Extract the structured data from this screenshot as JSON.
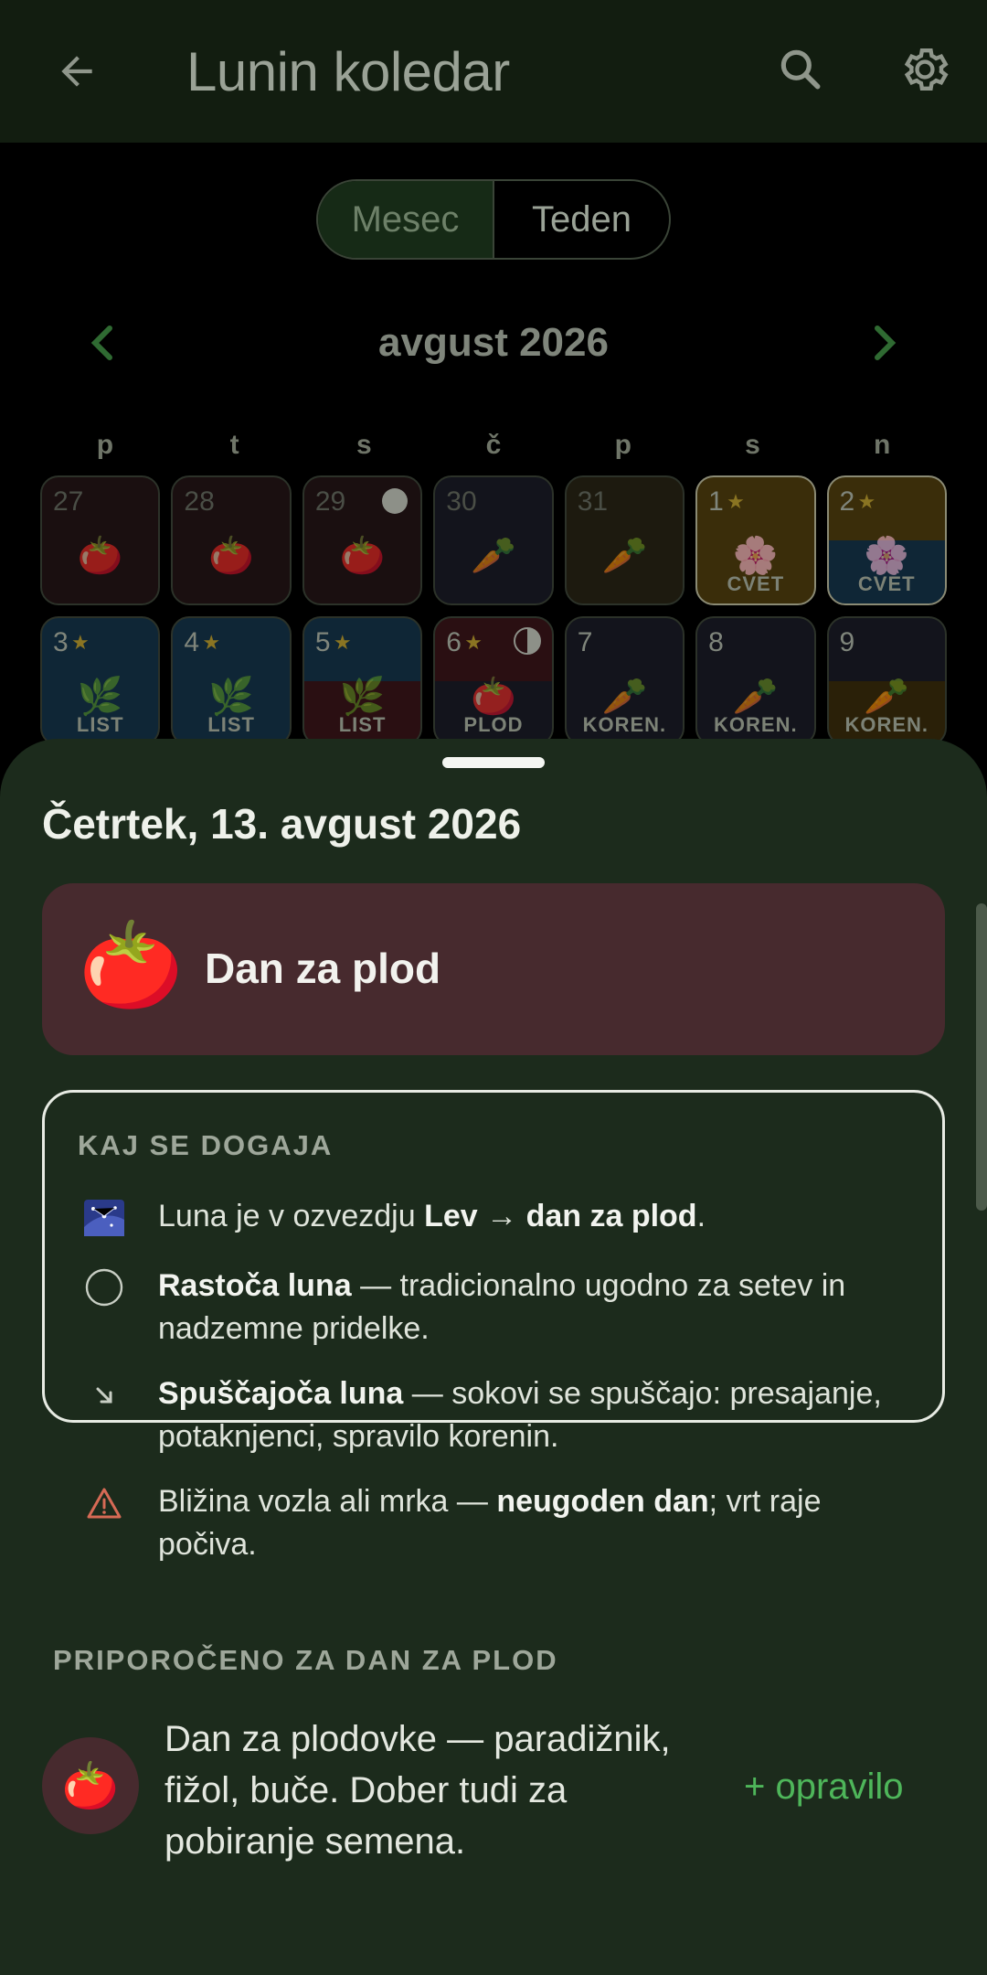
{
  "appbar": {
    "title": "Lunin koledar",
    "back_icon": "arrow-left-icon",
    "search_icon": "search-icon",
    "settings_icon": "gear-icon"
  },
  "view_toggle": {
    "month": "Mesec",
    "week": "Teden",
    "selected": "month"
  },
  "month_nav": {
    "title": "avgust 2026"
  },
  "weekdays": [
    "p",
    "t",
    "s",
    "č",
    "p",
    "s",
    "n"
  ],
  "calendar": {
    "rows": [
      [
        {
          "day": "27",
          "emoji": "🍅",
          "label": "",
          "star": false
        },
        {
          "day": "28",
          "emoji": "🍅",
          "label": "",
          "star": false
        },
        {
          "day": "29",
          "emoji": "🍅",
          "label": "",
          "star": false,
          "moon": "full"
        },
        {
          "day": "30",
          "emoji": "🥕",
          "label": "",
          "star": false
        },
        {
          "day": "31",
          "emoji": "🥕",
          "label": "",
          "star": false
        },
        {
          "day": "1",
          "emoji": "🌸",
          "label": "CVET",
          "star": true
        },
        {
          "day": "2",
          "emoji": "🌸",
          "label": "CVET",
          "star": true
        }
      ],
      [
        {
          "day": "3",
          "emoji": "🌿",
          "label": "LIST",
          "star": true
        },
        {
          "day": "4",
          "emoji": "🌿",
          "label": "LIST",
          "star": true
        },
        {
          "day": "5",
          "emoji": "🌿",
          "label": "LIST",
          "star": true
        },
        {
          "day": "6",
          "emoji": "🍅",
          "label": "PLOD",
          "star": true,
          "moon": "half"
        },
        {
          "day": "7",
          "emoji": "🥕",
          "label": "KOREN.",
          "star": false
        },
        {
          "day": "8",
          "emoji": "🥕",
          "label": "KOREN.",
          "star": false
        },
        {
          "day": "9",
          "emoji": "🥕",
          "label": "KOREN.",
          "star": false
        }
      ]
    ],
    "star_glyph": "★"
  },
  "sheet": {
    "date": "Četrtek, 13. avgust 2026",
    "day_type": {
      "emoji": "🍅",
      "text": "Dan za plod",
      "color": "#472a2e"
    },
    "info": {
      "heading": "KAJ SE DOGAJA",
      "items": [
        {
          "icon": "constellation-icon",
          "parts": [
            "Luna je v ozvezdju ",
            "Lev",
            " → ",
            "dan za plod",
            "."
          ]
        },
        {
          "icon": "waxing-moon-icon",
          "parts": [
            "Rastoča luna",
            " — tradicionalno ugodno za setev in nadzemne pridelke."
          ]
        },
        {
          "icon": "arrow-down-right-icon",
          "parts": [
            "Spuščajoča luna",
            " — sokovi se spuščajo: presajanje, potaknjenci, spravilo korenin."
          ]
        },
        {
          "icon": "warning-icon",
          "parts": [
            "Bližina vozla ali mrka — ",
            "neugoden dan",
            "; vrt raje počiva."
          ]
        }
      ]
    },
    "recommend": {
      "heading": "PRIPOROČENO ZA DAN ZA PLOD",
      "emoji": "🍅",
      "text": "Dan za plodovke — paradižnik, fižol, buče. Dober tudi za pobiranje semena.",
      "action": "+ opravilo"
    }
  },
  "colors": {
    "accent": "#4eb65a",
    "sheet_bg": "#1c2b1c",
    "fruit": "#472a2e"
  }
}
